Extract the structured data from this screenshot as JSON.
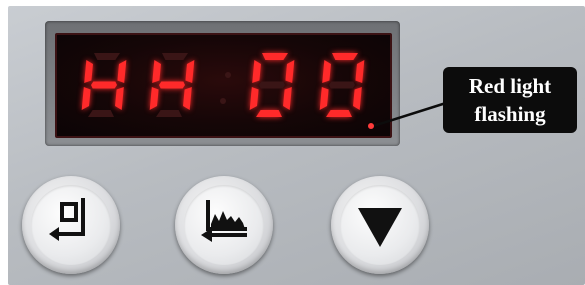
{
  "display": {
    "digits": [
      "H",
      "H",
      "0",
      "0"
    ],
    "led_color": "#ff2a2a",
    "led_off_color": "#3a1516"
  },
  "callout": {
    "line1": "Red light",
    "line2": "flashing"
  },
  "buttons": [
    {
      "icon": "enter-return-icon"
    },
    {
      "icon": "chart-return-icon"
    },
    {
      "icon": "down-triangle-icon"
    }
  ]
}
